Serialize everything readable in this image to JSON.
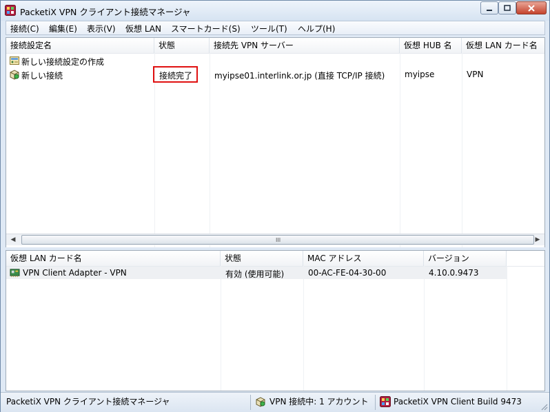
{
  "window": {
    "title": "PacketiX VPN クライアント接続マネージャ"
  },
  "menu": [
    "接続(C)",
    "編集(E)",
    "表示(V)",
    "仮想 LAN",
    "スマートカード(S)",
    "ツール(T)",
    "ヘルプ(H)"
  ],
  "connections": {
    "headers": [
      "接続設定名",
      "状態",
      "接続先 VPN サーバー",
      "仮想 HUB 名",
      "仮想 LAN カード名"
    ],
    "rows": [
      {
        "name": "新しい接続設定の作成",
        "status": "",
        "server": "",
        "hub": "",
        "adapter": "",
        "icon": "new-connection-icon"
      },
      {
        "name": "新しい接続",
        "status": "接続完了",
        "server": "myipse01.interlink.or.jp (直接 TCP/IP 接続)",
        "hub": "myipse",
        "adapter": "VPN",
        "icon": "connected-icon"
      }
    ],
    "scroll_grip": "III"
  },
  "adapters": {
    "headers": [
      "仮想 LAN カード名",
      "状態",
      "MAC アドレス",
      "バージョン"
    ],
    "rows": [
      {
        "name": "VPN Client Adapter - VPN",
        "status": "有効 (使用可能)",
        "mac": "00-AC-FE-04-30-00",
        "version": "4.10.0.9473",
        "icon": "network-adapter-icon"
      }
    ]
  },
  "statusbar": {
    "app": "PacketiX VPN クライアント接続マネージャ",
    "vpn": "VPN 接続中: 1 アカウント",
    "build": "PacketiX VPN Client Build 9473"
  },
  "colors": {
    "highlight_box": "#e01010",
    "window_frame": "#dfe9f5"
  }
}
